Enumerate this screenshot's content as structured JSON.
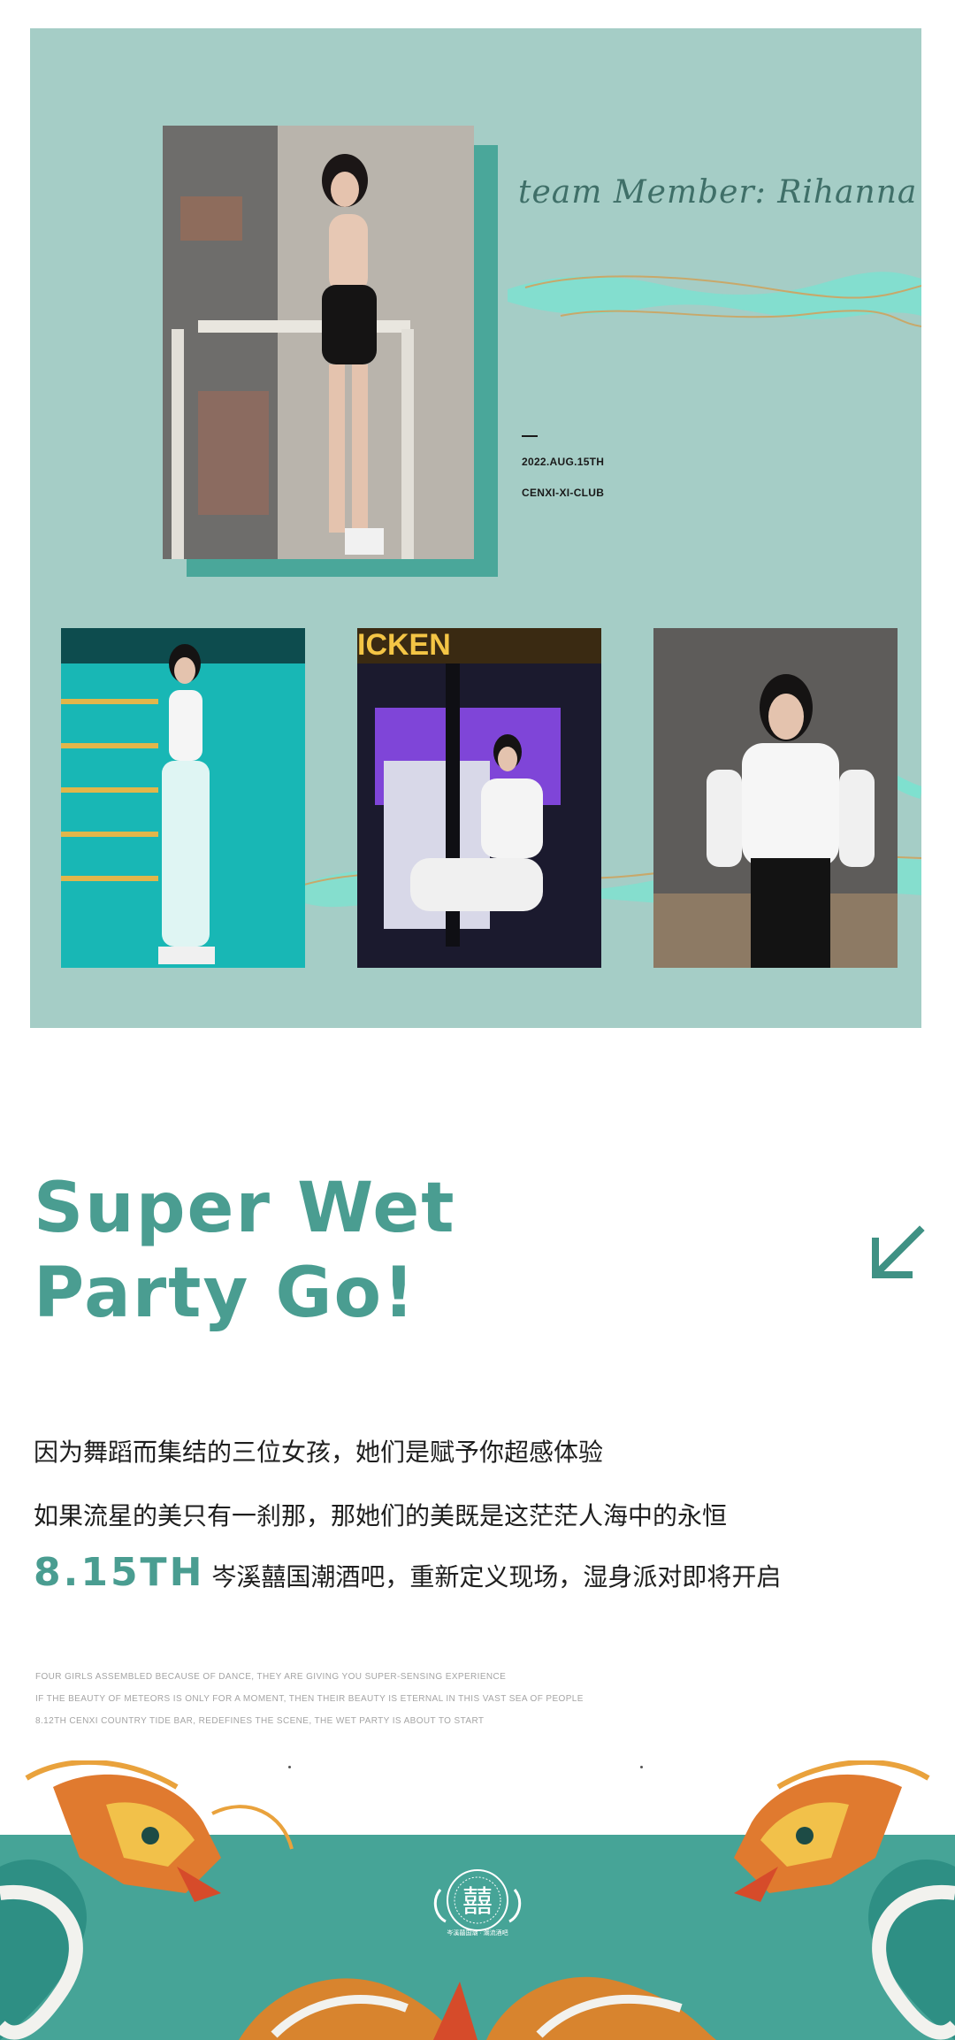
{
  "colors": {
    "panel_bg": "#a5cdc6",
    "accent_teal": "#4a9d91",
    "banner_teal": "#46a497",
    "shadow_teal": "#4aa79a"
  },
  "top_panel": {
    "member_line": "team Member: Rihanna",
    "date": "2022.AUG.15TH",
    "club": "CENXI-XI-CLUB"
  },
  "headline": {
    "line1": "Super Wet",
    "line2": "Party Go!"
  },
  "icons": {
    "arrow": "arrow-down-left-icon"
  },
  "paragraph_cn": {
    "line1": "因为舞蹈而集结的三位女孩，她们是赋予你超感体验",
    "line2": "如果流星的美只有一刹那，那她们的美既是这茫茫人海中的永恒",
    "line3_accent": "8.15TH",
    "line3_rest": "岑溪囍国潮酒吧，重新定义现场，湿身派对即将开启"
  },
  "paragraph_en": {
    "line1": "FOUR GIRLS ASSEMBLED BECAUSE OF DANCE, THEY ARE GIVING YOU SUPER-SENSING EXPERIENCE",
    "line2": "IF THE BEAUTY OF METEORS IS ONLY FOR A MOMENT, THEN THEIR BEAUTY IS ETERNAL IN THIS VAST SEA OF PEOPLE",
    "line3": "8.12TH CENXI COUNTRY TIDE BAR, REDEFINES THE SCENE, THE WET PARTY IS ABOUT TO START"
  },
  "emblem": {
    "glyph": "囍",
    "caption": "岑溪囍国潮 · 潮流酒吧"
  }
}
